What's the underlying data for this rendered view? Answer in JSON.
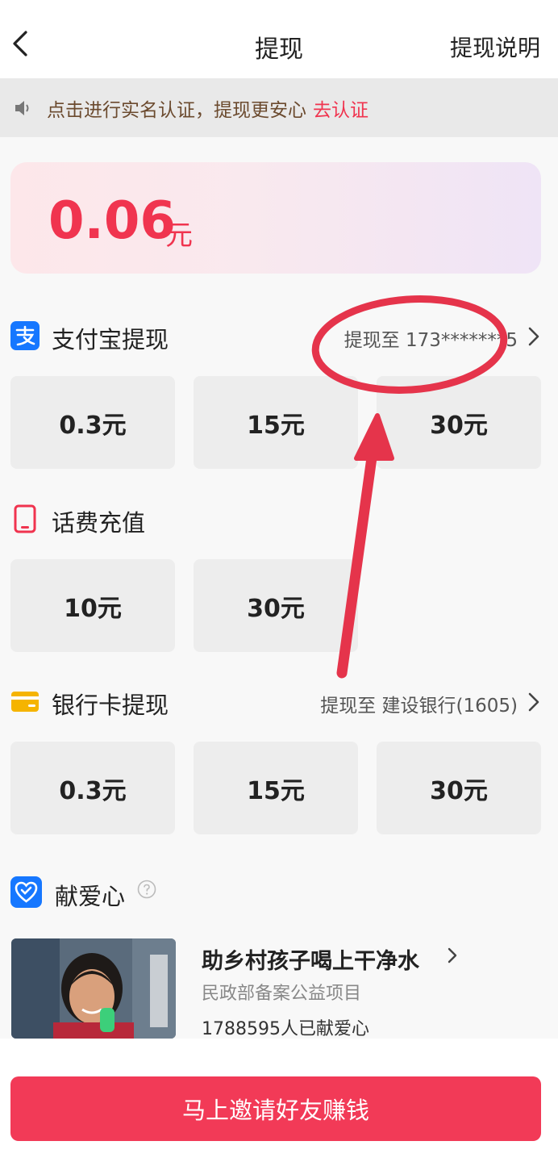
{
  "header": {
    "title": "提现",
    "explain_label": "提现说明"
  },
  "notice": {
    "text": "点击进行实名认证，提现更安心",
    "link": "去认证"
  },
  "balance": {
    "amount": "0.06",
    "unit": "元"
  },
  "alipay": {
    "label": "支付宝提现",
    "destination": "提现至 173*******5",
    "options": [
      "0.3元",
      "15元",
      "30元"
    ]
  },
  "phone": {
    "label": "话费充值",
    "options": [
      "10元",
      "30元"
    ]
  },
  "bank": {
    "label": "银行卡提现",
    "destination": "提现至 建设银行(1605)",
    "options": [
      "0.3元",
      "15元",
      "30元"
    ]
  },
  "charity": {
    "section_label": "献爱心",
    "project_name": "助乡村孩子喝上干净水",
    "organization": "民政部备案公益项目",
    "donors": "1788595人已献爱心"
  },
  "invite_button": "马上邀请好友赚钱",
  "colors": {
    "accent": "#f0344f",
    "alipay": "#1677ff",
    "bank": "#f5b400"
  },
  "icons": [
    "back-icon",
    "speaker-icon",
    "alipay-icon",
    "phone-icon",
    "bankcard-icon",
    "love-icon",
    "help-icon",
    "chevron-right-icon"
  ]
}
